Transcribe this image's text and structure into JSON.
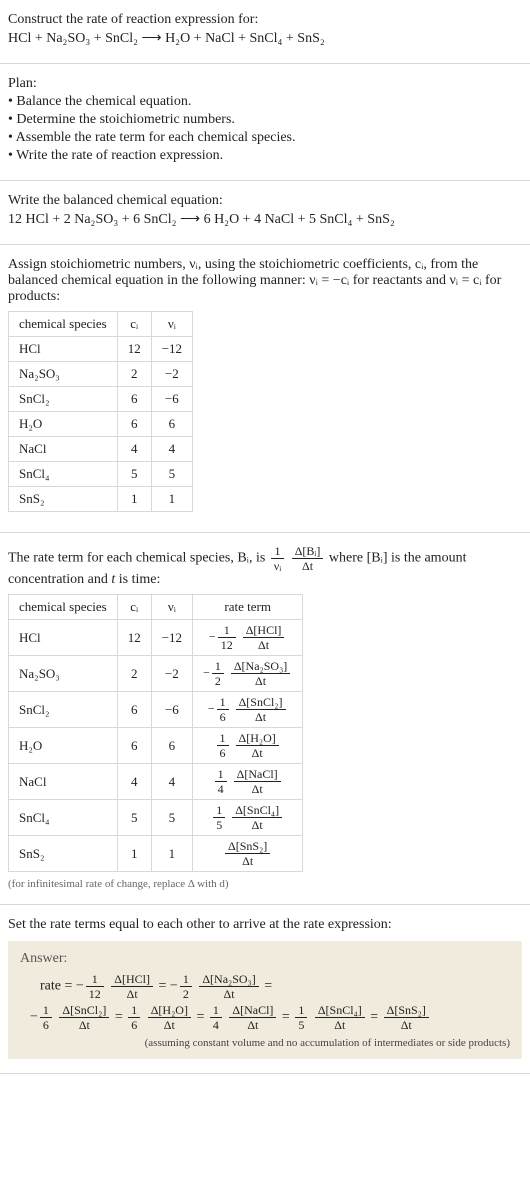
{
  "chart_data": [
    {
      "type": "table",
      "title": "Stoichiometric numbers",
      "columns": [
        "chemical species",
        "c_i",
        "ν_i"
      ],
      "rows": [
        [
          "HCl",
          12,
          -12
        ],
        [
          "Na2SO3",
          2,
          -2
        ],
        [
          "SnCl2",
          6,
          -6
        ],
        [
          "H2O",
          6,
          6
        ],
        [
          "NaCl",
          4,
          4
        ],
        [
          "SnCl4",
          5,
          5
        ],
        [
          "SnS2",
          1,
          1
        ]
      ]
    },
    {
      "type": "table",
      "title": "Rate terms",
      "columns": [
        "chemical species",
        "c_i",
        "ν_i",
        "rate term"
      ],
      "rows": [
        {
          "species": "HCl",
          "c": 12,
          "nu": -12,
          "sign": "-",
          "coef_num": "1",
          "coef_den": "12",
          "delta": "Δ[HCl]"
        },
        {
          "species": "Na2SO3",
          "c": 2,
          "nu": -2,
          "sign": "-",
          "coef_num": "1",
          "coef_den": "2",
          "delta": "Δ[Na2SO3]"
        },
        {
          "species": "SnCl2",
          "c": 6,
          "nu": -6,
          "sign": "-",
          "coef_num": "1",
          "coef_den": "6",
          "delta": "Δ[SnCl2]"
        },
        {
          "species": "H2O",
          "c": 6,
          "nu": 6,
          "sign": "",
          "coef_num": "1",
          "coef_den": "6",
          "delta": "Δ[H2O]"
        },
        {
          "species": "NaCl",
          "c": 4,
          "nu": 4,
          "sign": "",
          "coef_num": "1",
          "coef_den": "4",
          "delta": "Δ[NaCl]"
        },
        {
          "species": "SnCl4",
          "c": 5,
          "nu": 5,
          "sign": "",
          "coef_num": "1",
          "coef_den": "5",
          "delta": "Δ[SnCl4]"
        },
        {
          "species": "SnS2",
          "c": 1,
          "nu": 1,
          "sign": "",
          "coef_num": "",
          "coef_den": "",
          "delta": "Δ[SnS2]"
        }
      ]
    }
  ],
  "s1": {
    "l1": "Construct the rate of reaction expression for:",
    "l2": "HCl + Na₂SO₃ + SnCl₂  ⟶  H₂O + NaCl + SnCl₄ + SnS₂"
  },
  "s2": {
    "title": "Plan:",
    "b1": "• Balance the chemical equation.",
    "b2": "• Determine the stoichiometric numbers.",
    "b3": "• Assemble the rate term for each chemical species.",
    "b4": "• Write the rate of reaction expression."
  },
  "s3": {
    "l1": "Write the balanced chemical equation:",
    "l2": "12 HCl + 2 Na₂SO₃ + 6 SnCl₂  ⟶  6 H₂O + 4 NaCl + 5 SnCl₄ + SnS₂"
  },
  "s4": {
    "intro1": "Assign stoichiometric numbers, νᵢ, using the stoichiometric coefficients, cᵢ, from the balanced chemical equation in the following manner: νᵢ = −cᵢ for reactants and νᵢ = cᵢ for products:",
    "h1": "chemical species",
    "h2": "cᵢ",
    "h3": "νᵢ",
    "r1s": "HCl",
    "r1c": "12",
    "r1n": "−12",
    "r2s": "Na₂SO₃",
    "r2c": "2",
    "r2n": "−2",
    "r3s": "SnCl₂",
    "r3c": "6",
    "r3n": "−6",
    "r4s": "H₂O",
    "r4c": "6",
    "r4n": "6",
    "r5s": "NaCl",
    "r5c": "4",
    "r5n": "4",
    "r6s": "SnCl₄",
    "r6c": "5",
    "r6n": "5",
    "r7s": "SnS₂",
    "r7c": "1",
    "r7n": "1"
  },
  "s5": {
    "intro_a": "The rate term for each chemical species, Bᵢ, is ",
    "intro_frac_num": "1",
    "intro_frac_den": "νᵢ",
    "intro_dfrac_num": "Δ[Bᵢ]",
    "intro_dfrac_den": "Δt",
    "intro_b": " where [Bᵢ] is the amount concentration and ",
    "intro_t": "t",
    "intro_c": " is time:",
    "h1": "chemical species",
    "h2": "cᵢ",
    "h3": "νᵢ",
    "h4": "rate term",
    "r1s": "HCl",
    "r1c": "12",
    "r1n": "−12",
    "r2s": "Na₂SO₃",
    "r2c": "2",
    "r2n": "−2",
    "r3s": "SnCl₂",
    "r3c": "6",
    "r3n": "−6",
    "r4s": "H₂O",
    "r4c": "6",
    "r4n": "6",
    "r5s": "NaCl",
    "r5c": "4",
    "r5n": "4",
    "r6s": "SnCl₄",
    "r6c": "5",
    "r6n": "5",
    "r7s": "SnS₂",
    "r7c": "1",
    "r7n": "1",
    "rt1_sign": "−",
    "rt1_cn": "1",
    "rt1_cd": "12",
    "rt1_dn": "Δ[HCl]",
    "rt1_dd": "Δt",
    "rt2_sign": "−",
    "rt2_cn": "1",
    "rt2_cd": "2",
    "rt2_dn": "Δ[Na₂SO₃]",
    "rt2_dd": "Δt",
    "rt3_sign": "−",
    "rt3_cn": "1",
    "rt3_cd": "6",
    "rt3_dn": "Δ[SnCl₂]",
    "rt3_dd": "Δt",
    "rt4_sign": "",
    "rt4_cn": "1",
    "rt4_cd": "6",
    "rt4_dn": "Δ[H₂O]",
    "rt4_dd": "Δt",
    "rt5_sign": "",
    "rt5_cn": "1",
    "rt5_cd": "4",
    "rt5_dn": "Δ[NaCl]",
    "rt5_dd": "Δt",
    "rt6_sign": "",
    "rt6_cn": "1",
    "rt6_cd": "5",
    "rt6_dn": "Δ[SnCl₄]",
    "rt6_dd": "Δt",
    "rt7_dn": "Δ[SnS₂]",
    "rt7_dd": "Δt",
    "foot": "(for infinitesimal rate of change, replace Δ with d)"
  },
  "s6": {
    "title": "Set the rate terms equal to each other to arrive at the rate expression:",
    "answer_label": "Answer:",
    "rate_word": "rate = ",
    "minus": "−",
    "cn12": "1",
    "cd12": "12",
    "dn1": "Δ[HCl]",
    "dd": "Δt",
    "cn2": "1",
    "cd2": "2",
    "dn2": "Δ[Na₂SO₃]",
    "cn6": "1",
    "cd6": "6",
    "dn3": "Δ[SnCl₂]",
    "dn4": "Δ[H₂O]",
    "cn4": "1",
    "cd4": "4",
    "dn5": "Δ[NaCl]",
    "cn5": "1",
    "cd5": "5",
    "dn6": "Δ[SnCl₄]",
    "dn7": "Δ[SnS₂]",
    "eq": " = ",
    "assume": "(assuming constant volume and no accumulation of intermediates or side products)"
  }
}
